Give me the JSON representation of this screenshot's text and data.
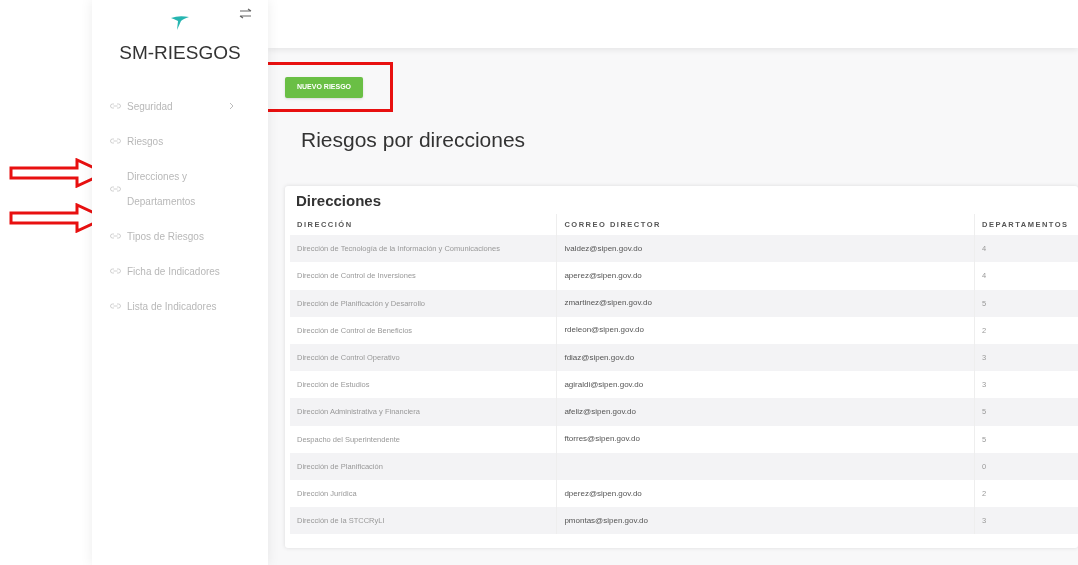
{
  "sidebar": {
    "brand": "SM-RIESGOS",
    "items": [
      {
        "label": "Seguridad",
        "has_submenu": true
      },
      {
        "label": "Riesgos",
        "has_submenu": false
      },
      {
        "label": "Direcciones y Departamentos",
        "has_submenu": false
      },
      {
        "label": "Tipos de Riesgos",
        "has_submenu": false
      },
      {
        "label": "Ficha de Indicadores",
        "has_submenu": false
      },
      {
        "label": "Lista de Indicadores",
        "has_submenu": false
      }
    ]
  },
  "new_button": "NUEVO RIESGO",
  "page_title": "Riesgos por direcciones",
  "table": {
    "title": "Direcciones",
    "columns": [
      "DIRECCIÓN",
      "CORREO DIRECTOR",
      "DEPARTAMENTOS"
    ],
    "rows": [
      [
        "Dirección de Tecnología de la Información y Comunicaciones",
        "lvaldez@sipen.gov.do",
        "4"
      ],
      [
        "Dirección de Control de Inversiones",
        "aperez@sipen.gov.do",
        "4"
      ],
      [
        "Dirección de Planificación y Desarrollo",
        "zmartinez@sipen.gov.do",
        "5"
      ],
      [
        "Dirección de Control de Beneficios",
        "rdeleon@sipen.gov.do",
        "2"
      ],
      [
        "Dirección de Control Operativo",
        "fdiaz@sipen.gov.do",
        "3"
      ],
      [
        "Dirección de Estudios",
        "agiraldi@sipen.gov.do",
        "3"
      ],
      [
        "Dirección Administrativa y Financiera",
        "afeliz@sipen.gov.do",
        "5"
      ],
      [
        "Despacho del Superintendente",
        "ftorres@sipen.gov.do",
        "5"
      ],
      [
        "Dirección de Planificación",
        "",
        "0"
      ],
      [
        "Dirección Jurídica",
        "dperez@sipen.gov.do",
        "2"
      ],
      [
        "Dirección de la STCCRyLI",
        "pmontas@sipen.gov.do",
        "3"
      ]
    ]
  }
}
